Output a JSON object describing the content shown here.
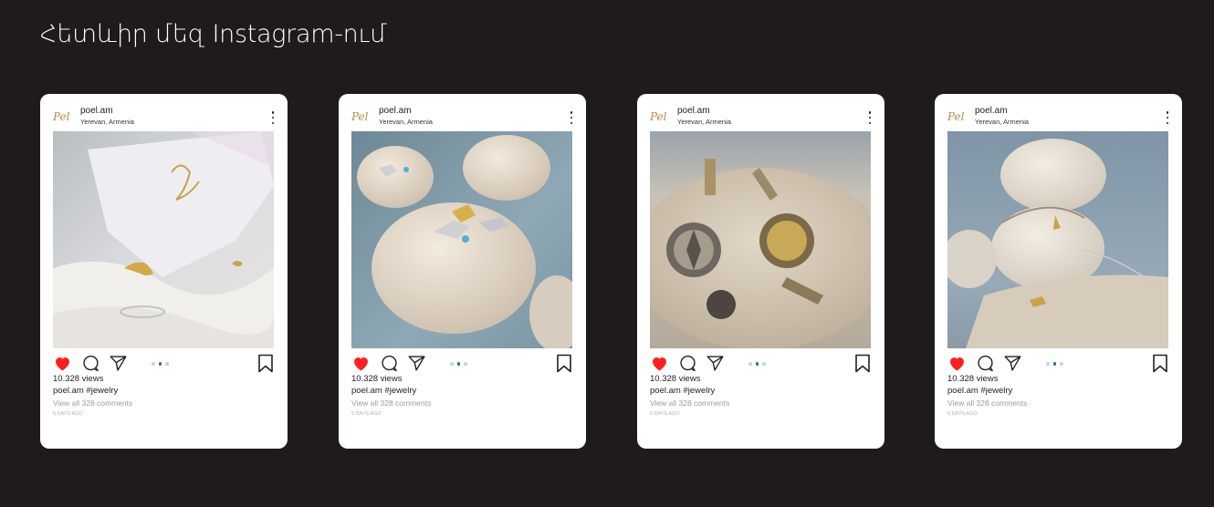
{
  "section": {
    "title": "Հետևիր մեզ Instagram-ում"
  },
  "colors": {
    "background": "#1f1b1a",
    "card": "#ffffff",
    "heart": "#ff1f1f",
    "active_dot": "#1f6fb5",
    "logo": "#b48a45"
  },
  "icons": {
    "like": "heart-icon",
    "comment": "comment-icon",
    "share": "paper-plane-icon",
    "save": "bookmark-icon",
    "menu": "more-vertical-icon"
  },
  "posts": [
    {
      "logo": "Pel",
      "handle": "poel.am",
      "location": "Yerevan, Armenia",
      "views": "10.328 views",
      "caption": "poel.am #jewelry",
      "comments": "View all 328 comments",
      "ago": "5 DAYS AGO",
      "liked": true,
      "carousel_active": 2,
      "carousel_total": 3
    },
    {
      "logo": "Pel",
      "handle": "poel.am",
      "location": "Yerevan, Armenia",
      "views": "10.328 views",
      "caption": "poel.am #jewelry",
      "comments": "View all 328 comments",
      "ago": "5 DAYS AGO",
      "liked": true,
      "carousel_active": 2,
      "carousel_total": 3
    },
    {
      "logo": "Pel",
      "handle": "poel.am",
      "location": "Yerevan, Armenia",
      "views": "10.328 views",
      "caption": "poel.am #jewelry",
      "comments": "View all 328 comments",
      "ago": "6 DAYS AGO",
      "liked": true,
      "carousel_active": 2,
      "carousel_total": 3
    },
    {
      "logo": "Pel",
      "handle": "poel.am",
      "location": "Yerevan, Armenia",
      "views": "10.328 views",
      "caption": "poel.am #jewelry",
      "comments": "View all 328 comments",
      "ago": "6 DAYS AGO",
      "liked": true,
      "carousel_active": 2,
      "carousel_total": 3
    }
  ]
}
